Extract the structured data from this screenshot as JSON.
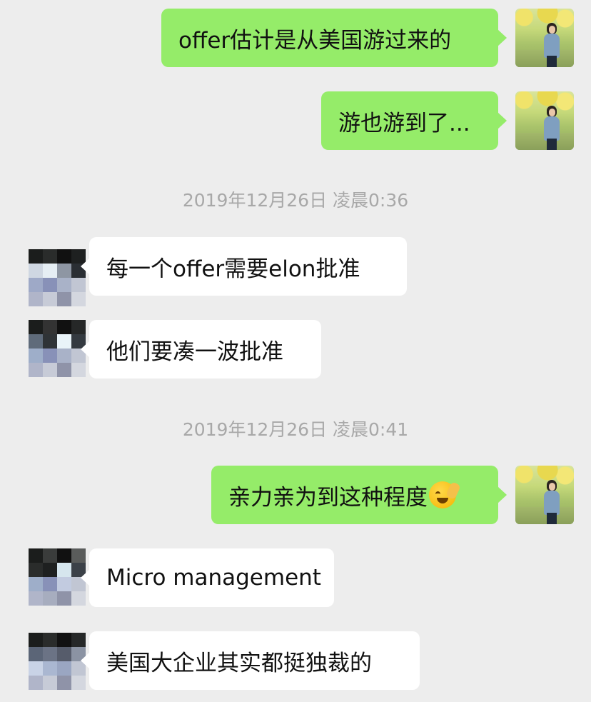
{
  "messages": [
    {
      "side": "me",
      "text": "offer估计是从美国游过来的"
    },
    {
      "side": "me",
      "text": "游也游到了..."
    },
    {
      "type": "time",
      "text": "2019年12月26日 凌晨0:36"
    },
    {
      "side": "them",
      "text": "每一个offer需要elon批准"
    },
    {
      "side": "them",
      "text": "他们要凑一波批准"
    },
    {
      "type": "time",
      "text": "2019年12月26日 凌晨0:41"
    },
    {
      "side": "me",
      "text": "亲力亲为到这种程度",
      "emoji": "facepalm-emoji"
    },
    {
      "side": "them",
      "text": "Micro management"
    },
    {
      "side": "them",
      "text": "美国大企业其实都挺独裁的"
    }
  ],
  "colors": {
    "background": "#ededed",
    "my_bubble": "#95ec69",
    "their_bubble": "#ffffff",
    "timestamp": "#a8a8a8"
  }
}
